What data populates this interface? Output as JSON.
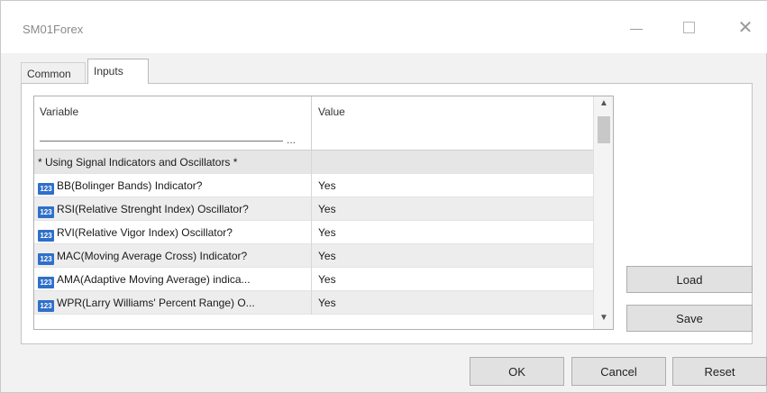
{
  "window": {
    "title": "SM01Forex",
    "minimize_glyph": "",
    "close_glyph": "✕"
  },
  "tabs": [
    {
      "label": "Common",
      "active": false
    },
    {
      "label": "Inputs",
      "active": true
    }
  ],
  "grid": {
    "columns": {
      "variable": "Variable",
      "value": "Value"
    },
    "header_ellipsis": "...",
    "group_label": "* Using Signal Indicators and Oscillators *",
    "type_icon": "123",
    "rows": [
      {
        "variable": "BB(Bolinger Bands) Indicator?",
        "value": "Yes"
      },
      {
        "variable": "RSI(Relative Strenght Index) Oscillator?",
        "value": "Yes"
      },
      {
        "variable": "RVI(Relative Vigor Index) Oscillator?",
        "value": "Yes"
      },
      {
        "variable": "MAC(Moving Average Cross) Indicator?",
        "value": "Yes"
      },
      {
        "variable": "AMA(Adaptive Moving Average) indica...",
        "value": "Yes"
      },
      {
        "variable": "WPR(Larry Williams' Percent Range) O...",
        "value": "Yes"
      }
    ],
    "scroll_up_glyph": "▲",
    "scroll_down_glyph": "▼"
  },
  "side_buttons": {
    "load": "Load",
    "save": "Save"
  },
  "footer_buttons": {
    "ok": "OK",
    "cancel": "Cancel",
    "reset": "Reset"
  }
}
